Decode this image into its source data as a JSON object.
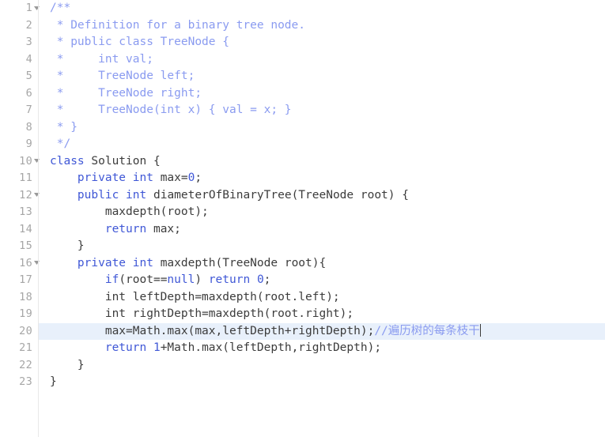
{
  "editor": {
    "name": "code-editor",
    "language": "java",
    "colors": {
      "background": "#ffffff",
      "gutter_text": "#a6a6a6",
      "gutter_separator": "#e8e8e8",
      "comment": "#8a9bf0",
      "keyword": "#3f57d6",
      "plain_text": "#3c3c3c",
      "active_line_background": "#e8f2fd",
      "caret": "#3c3c3c"
    },
    "active_line": 20,
    "cursor_line": 20,
    "fold_marker_glyph": "chevron-down",
    "fold_lines": [
      1,
      10,
      12,
      16
    ],
    "lines": [
      {
        "number": "1",
        "fold": true,
        "tokens": [
          {
            "text": "/**",
            "type": "comment"
          }
        ]
      },
      {
        "number": "2",
        "fold": false,
        "tokens": [
          {
            "text": " * Definition for a binary tree node.",
            "type": "comment"
          }
        ]
      },
      {
        "number": "3",
        "fold": false,
        "tokens": [
          {
            "text": " * public class TreeNode {",
            "type": "comment"
          }
        ]
      },
      {
        "number": "4",
        "fold": false,
        "tokens": [
          {
            "text": " *     int val;",
            "type": "comment"
          }
        ]
      },
      {
        "number": "5",
        "fold": false,
        "tokens": [
          {
            "text": " *     TreeNode left;",
            "type": "comment"
          }
        ]
      },
      {
        "number": "6",
        "fold": false,
        "tokens": [
          {
            "text": " *     TreeNode right;",
            "type": "comment"
          }
        ]
      },
      {
        "number": "7",
        "fold": false,
        "tokens": [
          {
            "text": " *     TreeNode(int x) { val = x; }",
            "type": "comment"
          }
        ]
      },
      {
        "number": "8",
        "fold": false,
        "tokens": [
          {
            "text": " * }",
            "type": "comment"
          }
        ]
      },
      {
        "number": "9",
        "fold": false,
        "tokens": [
          {
            "text": " */",
            "type": "comment"
          }
        ]
      },
      {
        "number": "10",
        "fold": true,
        "tokens": [
          {
            "text": "class",
            "type": "keyword"
          },
          {
            "text": " Solution {",
            "type": "plain"
          }
        ]
      },
      {
        "number": "11",
        "fold": false,
        "tokens": [
          {
            "text": "    ",
            "type": "plain"
          },
          {
            "text": "private",
            "type": "keyword"
          },
          {
            "text": " ",
            "type": "plain"
          },
          {
            "text": "int",
            "type": "keyword"
          },
          {
            "text": " max=",
            "type": "plain"
          },
          {
            "text": "0",
            "type": "number"
          },
          {
            "text": ";",
            "type": "plain"
          }
        ]
      },
      {
        "number": "12",
        "fold": true,
        "tokens": [
          {
            "text": "    ",
            "type": "plain"
          },
          {
            "text": "public",
            "type": "keyword"
          },
          {
            "text": " ",
            "type": "plain"
          },
          {
            "text": "int",
            "type": "keyword"
          },
          {
            "text": " diameterOfBinaryTree(TreeNode root) {",
            "type": "plain"
          }
        ]
      },
      {
        "number": "13",
        "fold": false,
        "tokens": [
          {
            "text": "        maxdepth(root);",
            "type": "plain"
          }
        ]
      },
      {
        "number": "14",
        "fold": false,
        "tokens": [
          {
            "text": "        ",
            "type": "plain"
          },
          {
            "text": "return",
            "type": "keyword"
          },
          {
            "text": " max;",
            "type": "plain"
          }
        ]
      },
      {
        "number": "15",
        "fold": false,
        "tokens": [
          {
            "text": "    }",
            "type": "plain"
          }
        ]
      },
      {
        "number": "16",
        "fold": true,
        "tokens": [
          {
            "text": "    ",
            "type": "plain"
          },
          {
            "text": "private",
            "type": "keyword"
          },
          {
            "text": " ",
            "type": "plain"
          },
          {
            "text": "int",
            "type": "keyword"
          },
          {
            "text": " maxdepth(TreeNode root){",
            "type": "plain"
          }
        ]
      },
      {
        "number": "17",
        "fold": false,
        "tokens": [
          {
            "text": "        ",
            "type": "plain"
          },
          {
            "text": "if",
            "type": "keyword"
          },
          {
            "text": "(root==",
            "type": "plain"
          },
          {
            "text": "null",
            "type": "keyword"
          },
          {
            "text": ") ",
            "type": "plain"
          },
          {
            "text": "return",
            "type": "keyword"
          },
          {
            "text": " ",
            "type": "plain"
          },
          {
            "text": "0",
            "type": "number"
          },
          {
            "text": ";",
            "type": "plain"
          }
        ]
      },
      {
        "number": "18",
        "fold": false,
        "tokens": [
          {
            "text": "        int leftDepth=maxdepth(root.left);",
            "type": "plain"
          }
        ]
      },
      {
        "number": "19",
        "fold": false,
        "tokens": [
          {
            "text": "        int rightDepth=maxdepth(root.right);",
            "type": "plain"
          }
        ]
      },
      {
        "number": "20",
        "fold": false,
        "active": true,
        "caret": true,
        "tokens": [
          {
            "text": "        max=Math.max(max,leftDepth+rightDepth);",
            "type": "plain"
          },
          {
            "text": "//遍历树的每条枝干",
            "type": "comment"
          }
        ]
      },
      {
        "number": "21",
        "fold": false,
        "tokens": [
          {
            "text": "        ",
            "type": "plain"
          },
          {
            "text": "return",
            "type": "keyword"
          },
          {
            "text": " ",
            "type": "plain"
          },
          {
            "text": "1",
            "type": "number"
          },
          {
            "text": "+Math.max(leftDepth,rightDepth);",
            "type": "plain"
          }
        ]
      },
      {
        "number": "22",
        "fold": false,
        "tokens": [
          {
            "text": "    }",
            "type": "plain"
          }
        ]
      },
      {
        "number": "23",
        "fold": false,
        "tokens": [
          {
            "text": "}",
            "type": "plain"
          }
        ]
      }
    ]
  }
}
